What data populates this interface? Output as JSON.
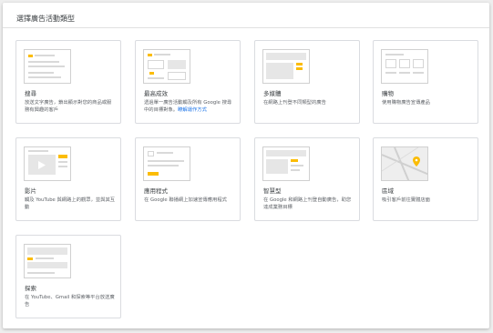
{
  "dialog": {
    "title": "選擇廣告活動類型"
  },
  "campaign_types": [
    {
      "key": "search",
      "title": "搜尋",
      "description": "放送文字廣告，鎖出顯示對您的商品或服務有興趣的客戶"
    },
    {
      "key": "smart",
      "title": "最高成效",
      "description": "透過單一廣告活動觸及所有 Google 搜尋中的目標對象。",
      "link": "瞭解運作方式"
    },
    {
      "key": "display",
      "title": "多媒體",
      "description": "在網路上刊登不同類型的廣告"
    },
    {
      "key": "shopping",
      "title": "購物",
      "description": "使用購物廣告宣傳產品"
    },
    {
      "key": "video",
      "title": "影片",
      "description": "觸及 YouTube 與網路上的觀眾，並與其互動"
    },
    {
      "key": "app",
      "title": "應用程式",
      "description": "在 Google 聯播網上加速宣傳應用程式"
    },
    {
      "key": "smart2",
      "title": "智慧型",
      "description": "在 Google 和網路上刊登自動廣告，助您達成業務目標"
    },
    {
      "key": "local",
      "title": "區域",
      "description": "吸引客戶前往實體店面"
    },
    {
      "key": "discovery",
      "title": "探索",
      "description": "在 YouTube、Gmail 和探索等平台放送廣告"
    }
  ],
  "colors": {
    "accent": "#fbbc04",
    "link": "#1a73e8"
  }
}
